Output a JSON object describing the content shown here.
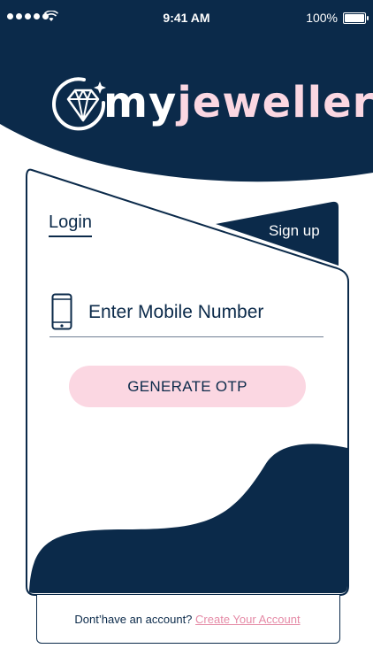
{
  "status_bar": {
    "time": "9:41 AM",
    "battery_percent": "100%",
    "signal_icon": "signal-dots-icon",
    "wifi_icon": "wifi-icon",
    "battery_icon": "battery-icon"
  },
  "logo": {
    "icon": "diamond-icon",
    "text_my": "my",
    "text_jeweller": "jeweller"
  },
  "tabs": {
    "login": "Login",
    "signup": "Sign up",
    "active": "login"
  },
  "form": {
    "mobile_placeholder": "Enter Mobile Number",
    "mobile_value": "",
    "phone_icon": "mobile-phone-icon",
    "otp_button": "GENERATE OTP"
  },
  "footer": {
    "prompt": "Dont’have an account?",
    "link": "Create Your Account"
  },
  "colors": {
    "navy": "#0b2a4a",
    "pink": "#fbd7e2",
    "link_pink": "#e58aa6",
    "white": "#ffffff"
  }
}
